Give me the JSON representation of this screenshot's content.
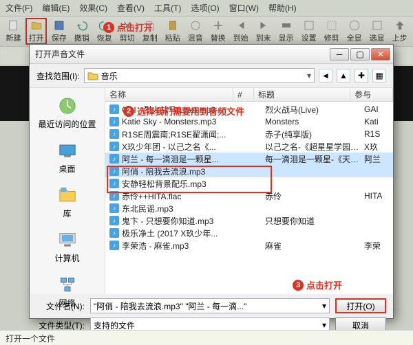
{
  "menu": {
    "file": "文件(F)",
    "edit": "编辑(E)",
    "effects": "效果(C)",
    "view": "查看(V)",
    "tools": "工具(T)",
    "options": "选项(O)",
    "window": "窗口(W)",
    "help": "帮助(H)"
  },
  "toolbar": {
    "new": "新建",
    "open": "打开",
    "save": "保存",
    "undo": "撤销",
    "redo": "恢复",
    "cut": "剪切",
    "copy": "复制",
    "paste": "粘贴",
    "mix": "混音",
    "replace": "替换",
    "goBegin": "到始",
    "goEnd": "到末",
    "show": "显示",
    "set": "设置",
    "trim": "修剪",
    "all": "全显",
    "save2": "选显",
    "up": "上步"
  },
  "callouts": {
    "c1": "点击打开",
    "c2": "选择我们需要用到音频文件",
    "c3": "点击打开"
  },
  "dialog": {
    "title": "打开声音文件",
    "lookIn": "查找范围(I):",
    "folder": "音乐",
    "columns": {
      "name": "名称",
      "num": "#",
      "title": "标题",
      "artist": "参与"
    },
    "places": {
      "recent": "最近访问的位置",
      "desktop": "桌面",
      "libs": "库",
      "computer": "计算机",
      "network": "网络"
    },
    "rows": [
      {
        "fn": "GAI - 烈火战马(Live).mp3",
        "title": "烈火战马(Live)",
        "artist": "GAI"
      },
      {
        "fn": "Katie Sky - Monsters.mp3",
        "title": "Monsters",
        "artist": "Kati"
      },
      {
        "fn": "R1SE周震南;R1SE翟潇闻;...",
        "title": "赤子(纯享版)",
        "artist": "R1S"
      },
      {
        "fn": "X玖少年团 - 以己之名《...",
        "title": "以己之名-《超星星学园》网...",
        "artist": "X玖"
      },
      {
        "fn": "阿兰 - 每一滴泪是一颗星...",
        "title": "每一滴泪是一颗星-《天醒之...",
        "artist": "阿兰",
        "sel": true
      },
      {
        "fn": "阿俏 - 陪我去流浪.mp3",
        "title": "",
        "artist": "",
        "sel": true
      },
      {
        "fn": "安静轻松背景配乐.mp3",
        "title": "",
        "artist": ""
      },
      {
        "fn": "赤伶++HITA.flac",
        "title": "赤伶",
        "artist": "HITA"
      },
      {
        "fn": "东北民谣.mp3",
        "title": "",
        "artist": ""
      },
      {
        "fn": "鬼卞 - 只想要你知道.mp3",
        "title": "只想要你知道",
        "artist": ""
      },
      {
        "fn": "极乐净土 (2017 X玖少年...",
        "title": "",
        "artist": ""
      },
      {
        "fn": "李荣浩 - 麻雀.mp3",
        "title": "麻雀",
        "artist": "李荣"
      }
    ],
    "fileNameLabel": "文件名(N):",
    "fileNameValue": "\"阿俏 - 陪我去流浪.mp3\" \"阿兰 - 每一滴...\"",
    "fileTypeLabel": "文件类型(T):",
    "fileTypeValue": "支持的文件",
    "openBtn": "打开(O)",
    "cancelBtn": "取消"
  },
  "status": "打开一个文件"
}
